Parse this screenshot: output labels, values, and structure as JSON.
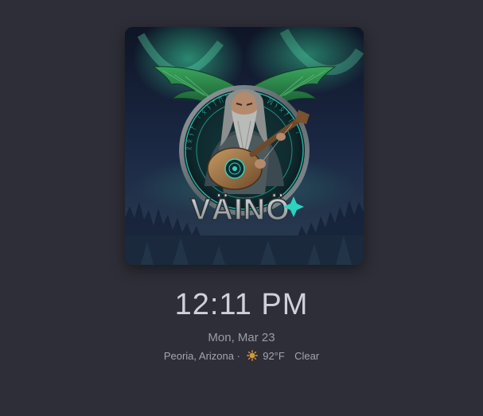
{
  "artwork": {
    "logo_text": "VÄINÖ",
    "rune_text": "ᚱᛟᚾᚨ ᚲᛟᚾᛏᛖᚱ ᚷᛚᛟᚠ ᛞᚾᛟᚨᛁᚾᚲ"
  },
  "clock": {
    "time": "12:11 PM",
    "date": "Mon, Mar 23"
  },
  "weather": {
    "location": "Peoria, Arizona",
    "separator": "·",
    "icon": "sun-icon",
    "temperature": "92°F",
    "condition": "Clear"
  },
  "colors": {
    "background": "#2e2e38",
    "aurora": "#2fb88a",
    "accent": "#2ed3c0",
    "sun": "#d59a3a"
  }
}
